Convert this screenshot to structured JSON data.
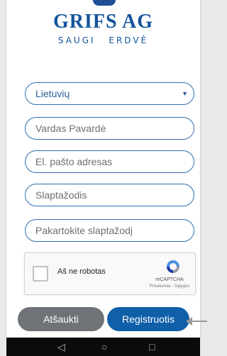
{
  "logo": {
    "name": "GRIFS AG",
    "tag_word1": "SAUGI",
    "tag_word2": "ERDVĖ"
  },
  "form": {
    "language_value": "Lietuvių",
    "name_placeholder": "Vardas Pavardė",
    "email_placeholder": "El. pašto adresas",
    "password_placeholder": "Slaptažodis",
    "repeat_password_placeholder": "Pakartokite slaptažodį"
  },
  "captcha": {
    "label": "Aš ne robotas",
    "brand": "reCAPTCHA",
    "links": "Privatumas - Sąlygos"
  },
  "buttons": {
    "cancel": "Atšaukti",
    "register": "Registruotis"
  },
  "colors": {
    "brand_blue": "#14549c",
    "register_blue": "#0f5fa9",
    "cancel_gray": "#6f7276"
  },
  "icons": {
    "back": "back-icon",
    "home": "home-icon",
    "recents": "recents-icon"
  }
}
